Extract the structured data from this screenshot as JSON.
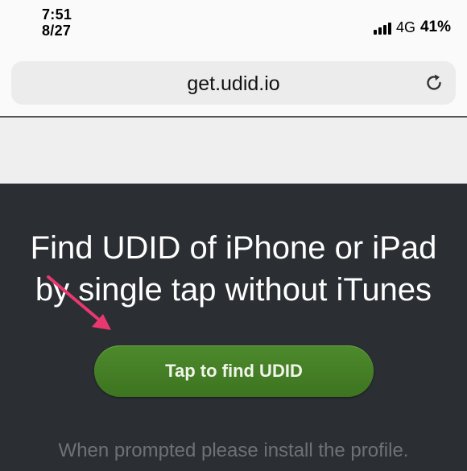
{
  "status_bar": {
    "time": "7:51",
    "date": "8/27",
    "network": "4G",
    "battery": "41%",
    "signal_icon": "cellular-signal-icon"
  },
  "browser": {
    "url": "get.udid.io",
    "reload_icon": "reload-icon"
  },
  "hero": {
    "headline_line1": "Find UDID of iPhone or iPad",
    "headline_line2": "by single tap without iTunes",
    "button_label": "Tap to find UDID",
    "hint": "When prompted please install the profile.",
    "arrow_icon": "arrow-pointer-icon"
  },
  "colors": {
    "hero_background": "#2b2f33",
    "button_green": "#4d8a2c",
    "arrow_pink": "#e8386f",
    "hint_gray": "#6d7277"
  }
}
